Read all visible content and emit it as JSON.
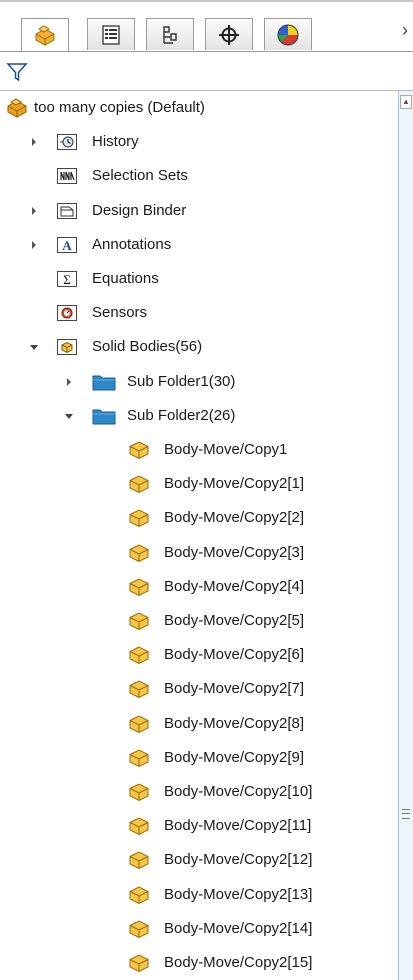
{
  "tabs": [
    {
      "name": "feature-manager",
      "icon": "part-icon",
      "active": true
    },
    {
      "name": "property-manager",
      "icon": "property-list-icon",
      "active": false
    },
    {
      "name": "configuration-manager",
      "icon": "configuration-icon",
      "active": false
    },
    {
      "name": "dimxpert-manager",
      "icon": "crosshair-icon",
      "active": false
    },
    {
      "name": "display-manager",
      "icon": "appearance-pie-icon",
      "active": false
    }
  ],
  "close_glyph": "›",
  "tree": {
    "root": {
      "label": "too many copies  (Default)",
      "icon": "part-icon"
    },
    "items": [
      {
        "label": "History",
        "icon": "history-icon",
        "expander": "collapsed"
      },
      {
        "label": "Selection Sets",
        "icon": "selection-sets-icon",
        "expander": "none"
      },
      {
        "label": "Design Binder",
        "icon": "design-binder-icon",
        "expander": "collapsed"
      },
      {
        "label": "Annotations",
        "icon": "annotations-icon",
        "expander": "collapsed"
      },
      {
        "label": "Equations",
        "icon": "equations-icon",
        "expander": "none"
      },
      {
        "label": "Sensors",
        "icon": "sensors-icon",
        "expander": "none"
      },
      {
        "label": "Solid Bodies(56)",
        "icon": "solid-bodies-icon",
        "expander": "expanded"
      }
    ],
    "folders": [
      {
        "label": "Sub Folder1(30)",
        "expander": "collapsed"
      },
      {
        "label": "Sub Folder2(26)",
        "expander": "expanded"
      }
    ],
    "bodies": [
      "Body-Move/Copy1",
      "Body-Move/Copy2[1]",
      "Body-Move/Copy2[2]",
      "Body-Move/Copy2[3]",
      "Body-Move/Copy2[4]",
      "Body-Move/Copy2[5]",
      "Body-Move/Copy2[6]",
      "Body-Move/Copy2[7]",
      "Body-Move/Copy2[8]",
      "Body-Move/Copy2[9]",
      "Body-Move/Copy2[10]",
      "Body-Move/Copy2[11]",
      "Body-Move/Copy2[12]",
      "Body-Move/Copy2[13]",
      "Body-Move/Copy2[14]",
      "Body-Move/Copy2[15]"
    ]
  },
  "colors": {
    "folder_blue": "#2f86c6",
    "body_yellow": "#f6c64a",
    "part_orange": "#e8a21c"
  }
}
